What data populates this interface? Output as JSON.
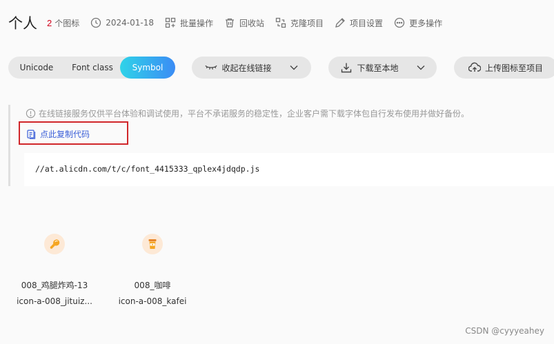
{
  "header": {
    "title": "个人",
    "icon_count": "2",
    "icon_count_label": "个图标",
    "date": "2024-01-18",
    "actions": {
      "batch": "批量操作",
      "recycle": "回收站",
      "clone": "克隆项目",
      "settings": "项目设置",
      "more": "更多操作"
    }
  },
  "toolbar": {
    "tabs": [
      "Unicode",
      "Font class",
      "Symbol"
    ],
    "active_tab": "Symbol",
    "collapse_label": "收起在线链接",
    "download_label": "下载至本地",
    "upload_label": "上传图标至项目"
  },
  "panel": {
    "notice": "在线链接服务仅供平台体验和调试使用，平台不承诺服务的稳定性，企业客户需下载字体包自行发布使用并做好备份。",
    "copy_label": "点此复制代码",
    "code": "//at.alicdn.com/t/c/font_4415333_qplex4jdqdp.js"
  },
  "icons": [
    {
      "name": "008_鸡腿炸鸡-13",
      "code": "icon-a-008_jituiz...",
      "icon": "drumstick-icon"
    },
    {
      "name": "008_咖啡",
      "code": "icon-a-008_kafei",
      "icon": "coffee-cup-icon"
    }
  ],
  "watermark": "CSDN @cyyyeahey",
  "colors": {
    "accent_gradient_start": "#2fd3e8",
    "accent_gradient_end": "#3b8cf5",
    "count_red": "#d0021b",
    "link_blue": "#3b5fd8",
    "highlight_border": "#d0262a",
    "icon_orange": "#f5a623"
  }
}
